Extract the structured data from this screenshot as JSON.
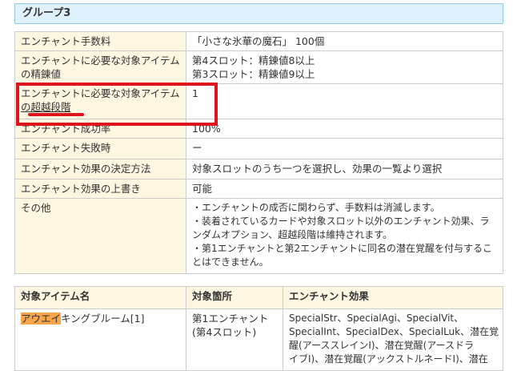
{
  "group": {
    "title": "グループ3"
  },
  "info_rows": [
    {
      "label": [
        "エンチャント手数料"
      ],
      "value": [
        "「小さな氷華の魔石」 100個"
      ]
    },
    {
      "label": [
        "エンチャントに必要な対象アイテム",
        "の精錬値"
      ],
      "value": [
        "第4スロット：精錬値8以上",
        "第3スロット：精錬値9以上"
      ]
    },
    {
      "label": [
        "エンチャントに必要な対象アイテム",
        "の超越段階"
      ],
      "value": [
        "1"
      ]
    },
    {
      "label": [
        "エンチャント成功率"
      ],
      "value": [
        "100%"
      ]
    },
    {
      "label": [
        "エンチャント失敗時"
      ],
      "value": [
        "ー"
      ]
    },
    {
      "label": [
        "エンチャント効果の決定方法"
      ],
      "value": [
        "対象スロットのうち一つを選択し、効果の一覧より選択"
      ]
    },
    {
      "label": [
        "エンチャント効果の上書き"
      ],
      "value": [
        "可能"
      ]
    },
    {
      "label": [
        "その他"
      ],
      "value": [
        "・エンチャントの成否に関わらず、手数料は消滅します。",
        "・装着されているカードや対象スロット以外のエンチャント効果、ラ",
        "ンダムオプション、超越段階は維持されます。",
        "・第1エンチャントと第2エンチャントに同名の潜在覚醒を付与するこ",
        "とはできません。"
      ]
    }
  ],
  "items_table": {
    "headers": [
      "対象アイテム名",
      "対象箇所",
      "エンチャント効果"
    ],
    "rows": [
      {
        "name_highlight": "アウエイ",
        "name_rest": "キングブルーム[1]",
        "location": [
          "第1エンチャント",
          "(第4スロット)"
        ],
        "effects": [
          "SpecialStr、SpecialAgi、SpecialVit、",
          "SpecialInt、SpecialDex、SpecialLuk、潜在覚",
          "醒(アーススレインI)、潜在覚醒(アースドラ",
          "イブI)、潜在覚醒(アックストルネードI)、潜在"
        ]
      }
    ]
  },
  "annotation": {
    "color": "#e0121b"
  },
  "colors": {
    "label_bg": "#fdf6e0",
    "header_bg": "#dff1fa",
    "highlight": "#f7a54a"
  }
}
